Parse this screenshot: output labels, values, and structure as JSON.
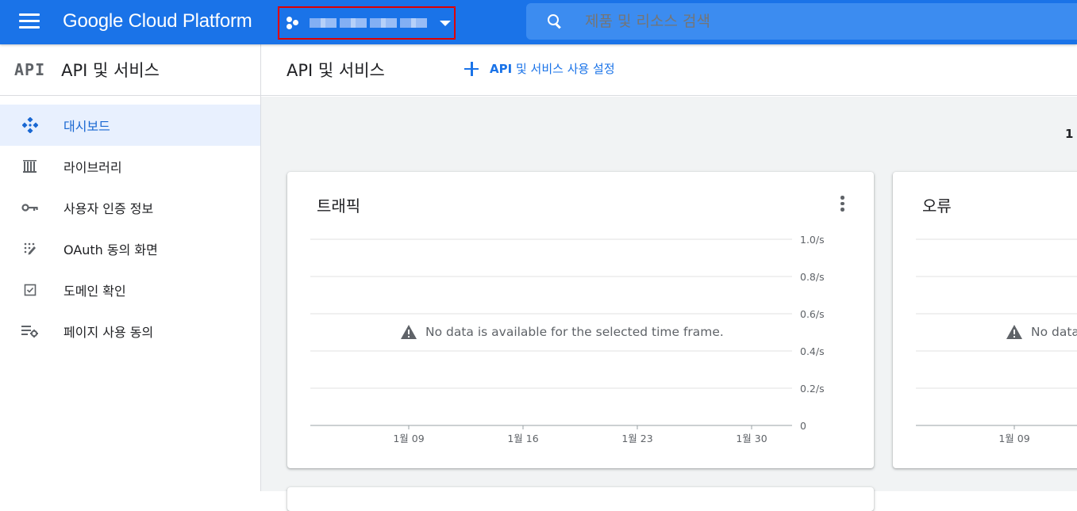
{
  "header": {
    "brand": "Google Cloud Platform",
    "project_name": "",
    "search_placeholder": "제품 및 리소스 검색"
  },
  "sidebar": {
    "logo": "API",
    "title": "API 및 서비스",
    "items": [
      {
        "label": "대시보드",
        "icon": "dashboard-icon",
        "active": true
      },
      {
        "label": "라이브러리",
        "icon": "library-icon",
        "active": false
      },
      {
        "label": "사용자 인증 정보",
        "icon": "key-icon",
        "active": false
      },
      {
        "label": "OAuth 동의 화면",
        "icon": "oauth-consent-icon",
        "active": false
      },
      {
        "label": "도메인 확인",
        "icon": "checkbox-icon",
        "active": false
      },
      {
        "label": "페이지 사용 동의",
        "icon": "page-settings-icon",
        "active": false
      }
    ]
  },
  "main": {
    "title": "API 및 서비스",
    "enable_button": {
      "bold": "API",
      "rest": " 및 서비스 사용 설정"
    },
    "partial_text": "1",
    "cards": [
      {
        "title": "트래픽",
        "nodata": "No data is available for the selected time frame."
      },
      {
        "title": "오류",
        "nodata": "No data"
      }
    ]
  },
  "colors": {
    "accent": "#1a73e8",
    "active_bg": "#e8f0fe",
    "page_bg": "#f1f3f4",
    "highlight_border": "#e00000"
  },
  "chart_data": [
    {
      "type": "line",
      "title": "트래픽",
      "y_ticks": [
        "1.0/s",
        "0.8/s",
        "0.6/s",
        "0.4/s",
        "0.2/s",
        "0"
      ],
      "x_ticks": [
        "1월 09",
        "1월 16",
        "1월 23",
        "1월 30"
      ],
      "ylim": [
        0,
        1.0
      ],
      "series": [],
      "grid": true,
      "annotation": "No data is available for the selected time frame."
    },
    {
      "type": "line",
      "title": "오류",
      "x_ticks": [
        "1월 09"
      ],
      "series": [],
      "grid": true,
      "annotation": "No data"
    }
  ]
}
